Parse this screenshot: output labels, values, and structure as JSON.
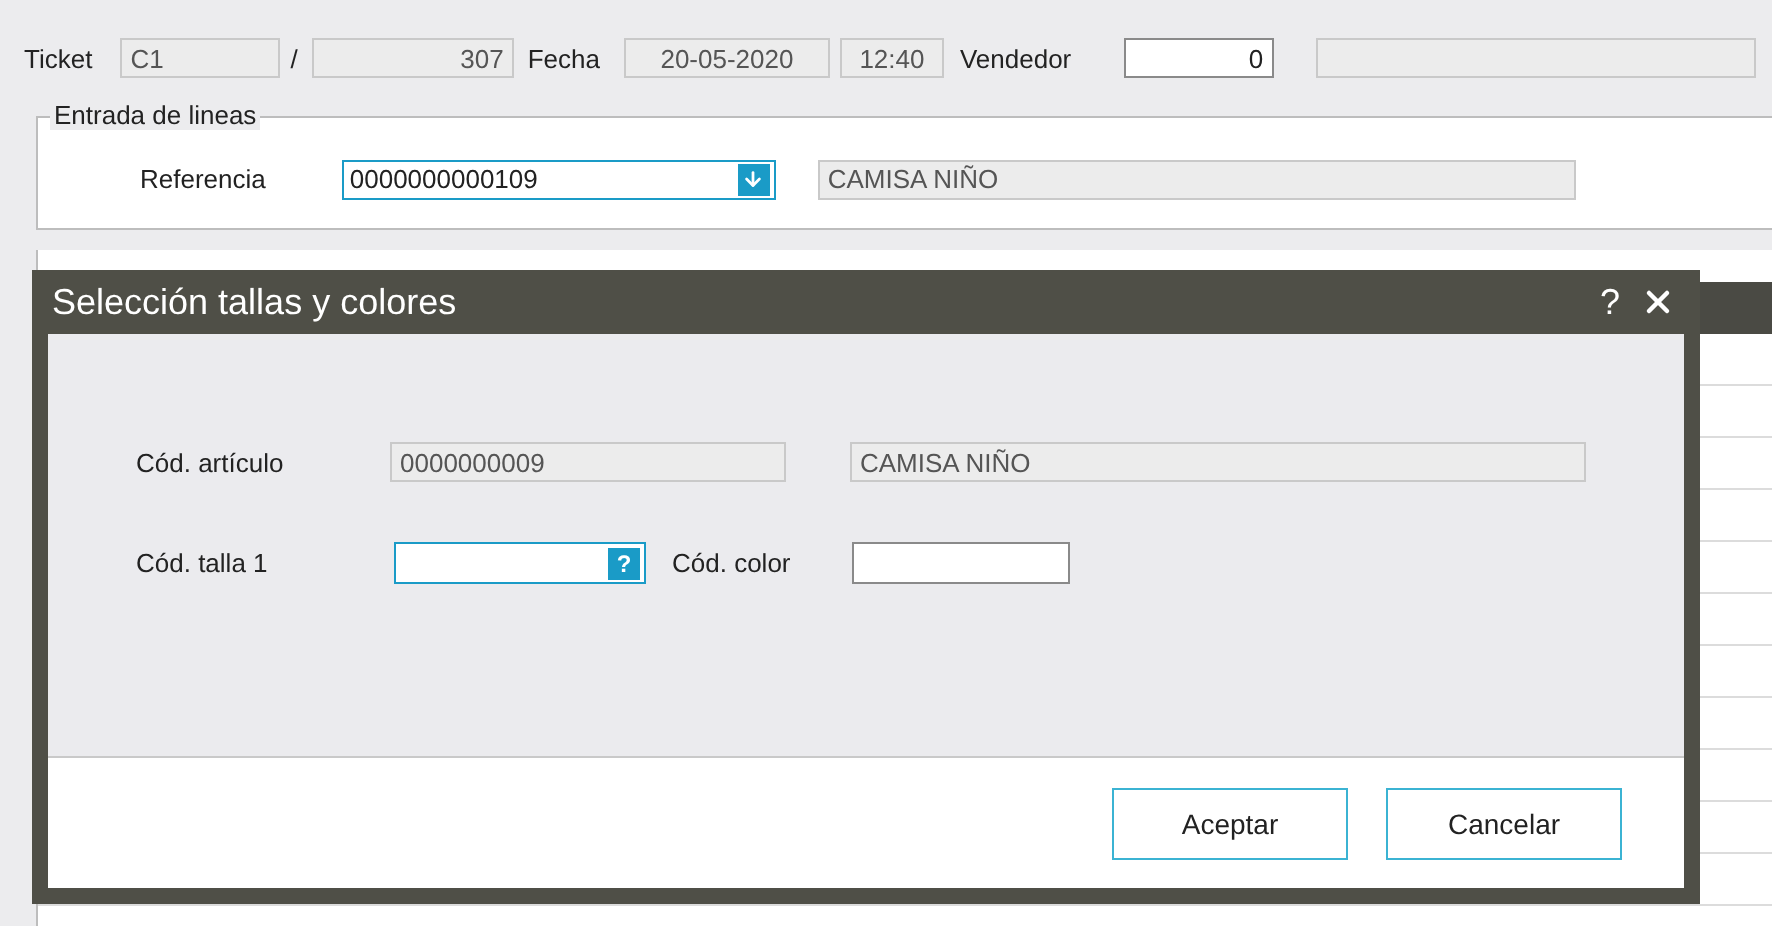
{
  "header": {
    "ticket_label": "Ticket",
    "series": "C1",
    "separator": "/",
    "number": "307",
    "fecha_label": "Fecha",
    "date": "20-05-2020",
    "time": "12:40",
    "vendedor_label": "Vendedor",
    "vendedor": "0"
  },
  "line_entry": {
    "legend": "Entrada de lineas",
    "referencia_label": "Referencia",
    "referencia": "0000000000109",
    "referencia_focused": true,
    "description": "CAMISA NIÑO"
  },
  "dialog": {
    "title": "Selección tallas y colores",
    "help": "?",
    "articulo_label": "Cód. artículo",
    "articulo": "0000000009",
    "articulo_desc": "CAMISA NIÑO",
    "talla_label": "Cód. talla 1",
    "talla_focused": true,
    "talla_lookup": "?",
    "color_label": "Cód. color",
    "buttons": [
      "Aceptar",
      "Cancelar"
    ]
  }
}
